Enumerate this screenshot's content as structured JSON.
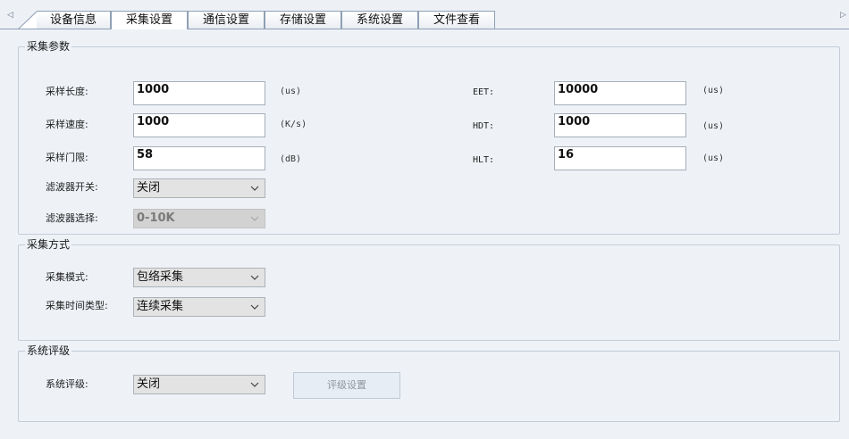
{
  "tabs": [
    {
      "label": "设备信息",
      "active": false
    },
    {
      "label": "采集设置",
      "active": true
    },
    {
      "label": "通信设置",
      "active": false
    },
    {
      "label": "存储设置",
      "active": false
    },
    {
      "label": "系统设置",
      "active": false
    },
    {
      "label": "文件查看",
      "active": false
    }
  ],
  "nav": {
    "left": "◁",
    "right": "▷"
  },
  "acquisition_params": {
    "title": "采集参数",
    "sample_length": {
      "label": "采样长度:",
      "value": "1000",
      "unit": "(us)"
    },
    "sample_speed": {
      "label": "采样速度:",
      "value": "1000",
      "unit": "(K/s)"
    },
    "sample_threshold": {
      "label": "采样门限:",
      "value": "58",
      "unit": "(dB)"
    },
    "filter_switch": {
      "label": "滤波器开关:",
      "value": "关闭"
    },
    "filter_select": {
      "label": "滤波器选择:",
      "value": "0-10K"
    },
    "eet": {
      "label": "EET:",
      "value": "10000",
      "unit": "(us)"
    },
    "hdt": {
      "label": "HDT:",
      "value": "1000",
      "unit": "(us)"
    },
    "hlt": {
      "label": "HLT:",
      "value": "16",
      "unit": "(us)"
    }
  },
  "acquisition_mode": {
    "title": "采集方式",
    "mode": {
      "label": "采集模式:",
      "value": "包络采集"
    },
    "time_type": {
      "label": "采集时间类型:",
      "value": "连续采集"
    }
  },
  "system_rating": {
    "title": "系统评级",
    "rating": {
      "label": "系统评级:",
      "value": "关闭"
    },
    "settings_button": "评级设置"
  },
  "colors": {
    "background": "#eef2f7",
    "border": "#c5ccd6",
    "tab_border": "#8fa0b4"
  }
}
